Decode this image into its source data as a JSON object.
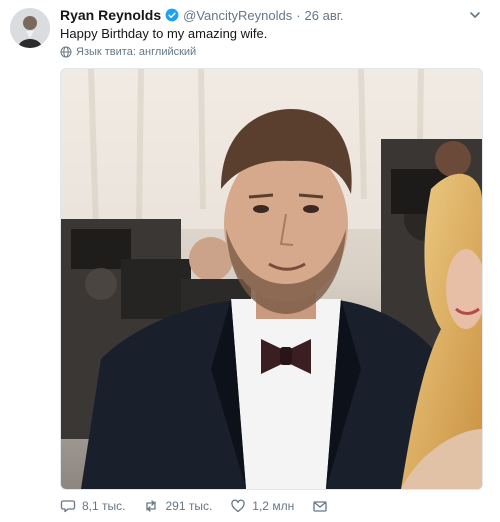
{
  "tweet": {
    "author_name": "Ryan Reynolds",
    "handle": "@VancityReynolds",
    "separator": "·",
    "date": "26 авг.",
    "text": "Happy Birthday to my amazing wife.",
    "language_note": "Язык твита: английский"
  },
  "actions": {
    "reply_count": "8,1 тыс.",
    "retweet_count": "291 тыс.",
    "like_count": "1,2 млн"
  },
  "colors": {
    "verified_blue": "#1da1f2",
    "muted_gray": "#657786",
    "text_dark": "#14171a"
  },
  "icons": [
    "verified-badge-icon",
    "chevron-down-icon",
    "globe-icon",
    "reply-icon",
    "retweet-icon",
    "like-icon",
    "message-icon"
  ]
}
